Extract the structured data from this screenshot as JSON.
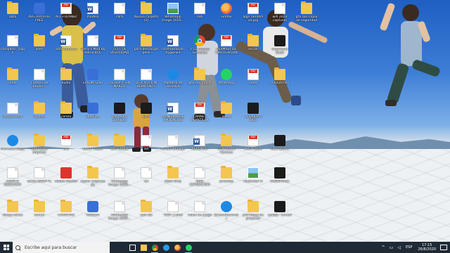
{
  "desktop": {
    "icons": [
      {
        "label": "data",
        "type": "folder"
      },
      {
        "label": "AVG AntiVirus FREE",
        "type": "exe"
      },
      {
        "label": "ACF+OcANEt",
        "type": "pdf"
      },
      {
        "label": "modelo",
        "type": "word"
      },
      {
        "label": "cara",
        "type": "doc"
      },
      {
        "label": "Nueva carpeta (2)",
        "type": "folder"
      },
      {
        "label": "WhatsApp Image 2020...",
        "type": "image"
      },
      {
        "label": "ceb",
        "type": "doc"
      },
      {
        "label": "Firefox",
        "type": "appfirefox"
      },
      {
        "label": "algo random xd.jpg",
        "type": "pdf"
      },
      {
        "label": "wifi 2020 capturas",
        "type": "doc"
      },
      {
        "label": "gta san copia de seguridad",
        "type": "folder"
      },
      {
        "label": "compartir_copia",
        "type": "doc"
      },
      {
        "label": "lines",
        "type": "folder"
      },
      {
        "label": "lista numeros",
        "type": "word"
      },
      {
        "label": "Garry s Mod By Admin4Ck",
        "type": "doc"
      },
      {
        "label": "TEST DE VELOCIDAD",
        "type": "pdf"
      },
      {
        "label": "para descargar pelis",
        "type": "folder"
      },
      {
        "label": "normalizacion hygiene1",
        "type": "word"
      },
      {
        "label": "1:11 Andrea Gonzalez",
        "type": "appchrome"
      },
      {
        "label": "PERMISO DE CIRCULACION",
        "type": "pdf"
      },
      {
        "label": "escan",
        "type": "folder"
      },
      {
        "label": "Geometry Dash",
        "type": "appdark"
      },
      {
        "label": "mele",
        "type": "folder"
      },
      {
        "label": "Cambio de Studio...",
        "type": "doc"
      },
      {
        "label": "audio",
        "type": "folder"
      },
      {
        "label": "EPSON Scan",
        "type": "exe"
      },
      {
        "label": "DEUDA A FIN MARZO",
        "type": "doc"
      },
      {
        "label": "DEVOLUCION REMITENTE",
        "type": "doc"
      },
      {
        "label": "Papelera de reciclaje",
        "type": "appblue"
      },
      {
        "label": "gta san copia",
        "type": "folder"
      },
      {
        "label": "WhatsApp",
        "type": "appgreen"
      },
      {
        "label": "nosel",
        "type": "pdf"
      },
      {
        "label": "rendytimes",
        "type": "folder"
      },
      {
        "label": "limpiar cmd",
        "type": "doc"
      },
      {
        "label": "Dyfreo",
        "type": "folder"
      },
      {
        "label": "carola",
        "type": "folder"
      },
      {
        "label": "OptiFine",
        "type": "exe"
      },
      {
        "label": "Plants vs Zombies",
        "type": "appdark"
      },
      {
        "label": "GYG",
        "type": "appdark"
      },
      {
        "label": "PRINCIPAL DE APLICACION",
        "type": "word"
      },
      {
        "label": "CARNET PLANTILLA",
        "type": "pdf"
      },
      {
        "label": "soten",
        "type": "folder"
      },
      {
        "label": "VEGAS Pro 18.0",
        "type": "appdark"
      },
      {
        "label": "Microsoft Edge",
        "type": "appblue"
      },
      {
        "label": "fotos para imprimir",
        "type": "folder"
      },
      {
        "label": "lolo",
        "type": "pdf"
      },
      {
        "label": "build - copia",
        "type": "folder"
      },
      {
        "label": "BAT Studio",
        "type": "folder"
      },
      {
        "label": "ed",
        "type": "doc"
      },
      {
        "label": "recibo de pago",
        "type": "doc"
      },
      {
        "label": "RECORDS",
        "type": "word"
      },
      {
        "label": "GTB Studio Camera",
        "type": "folder"
      },
      {
        "label": "ARCH 2020",
        "type": "pdf"
      },
      {
        "label": "OBS Studio",
        "type": "appdark"
      },
      {
        "label": "CODICE DERIVADO",
        "type": "doc"
      },
      {
        "label": "darya SWUP FL",
        "type": "doc"
      },
      {
        "label": "Adobe Reader",
        "type": "appred"
      },
      {
        "label": "copiar virgenes de",
        "type": "folder"
      },
      {
        "label": "WhatsApp Image 2020...",
        "type": "doc"
      },
      {
        "label": "ult",
        "type": "doc"
      },
      {
        "label": "Work Gray",
        "type": "folder"
      },
      {
        "label": "BMS COTIZACION",
        "type": "doc"
      },
      {
        "label": "juriadisp",
        "type": "folder"
      },
      {
        "label": "Illustrator 8",
        "type": "image"
      },
      {
        "label": "UNDERTALE",
        "type": "appdark"
      },
      {
        "label": "discos duros",
        "type": "folder"
      },
      {
        "label": "winrar",
        "type": "folder"
      },
      {
        "label": "CARPETAS",
        "type": "folder"
      },
      {
        "label": "MSPaint",
        "type": "exe"
      },
      {
        "label": "WhatsApp Image 2020...",
        "type": "doc"
      },
      {
        "label": "ryle sat",
        "type": "folder"
      },
      {
        "label": "TEST 1 final",
        "type": "doc"
      },
      {
        "label": "video de juego",
        "type": "doc"
      },
      {
        "label": "ScreenRecorder",
        "type": "appblue"
      },
      {
        "label": "pro-mapa de proyecto",
        "type": "folder"
      },
      {
        "label": "ps4dp - unreal",
        "type": "appdark"
      }
    ]
  },
  "taskbar": {
    "search_placeholder": "Escribe aquí para buscar",
    "pinned": [
      "file-explorer",
      "chrome",
      "edge",
      "firefox",
      "whatsapp"
    ],
    "tray": {
      "language": "ESP",
      "time": "17:15",
      "date": "26/8/2020"
    }
  },
  "colors": {
    "taskbar": "#1f2a36",
    "folder": "#f3c64e"
  }
}
